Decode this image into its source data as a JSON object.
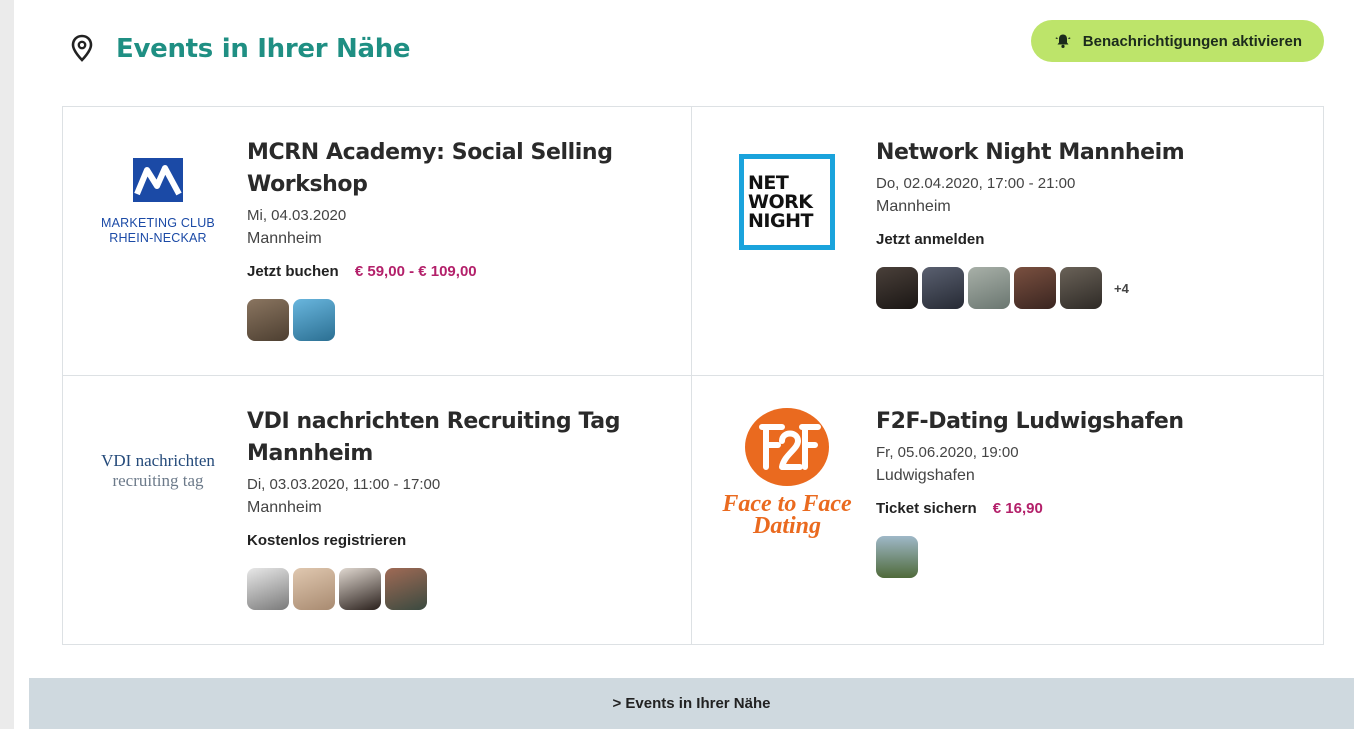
{
  "header": {
    "title": "Events in Ihrer Nähe",
    "notify_label": "Benachrichtigungen aktivieren"
  },
  "events": [
    {
      "title": "MCRN Academy: Social Selling Workshop",
      "date": "Mi, 04.03.2020",
      "location": "Mannheim",
      "cta": "Jetzt buchen",
      "price": "€ 59,00 - € 109,00",
      "logo": {
        "line1": "MARKETING CLUB",
        "line2": "RHEIN-NECKAR"
      },
      "attendee_colors": [
        "#6b5a45",
        "#3f8fb5"
      ]
    },
    {
      "title": "Network Night Mannheim",
      "date": "Do, 02.04.2020, 17:00 - 21:00",
      "location": "Mannheim",
      "cta": "Jetzt anmelden",
      "more_attendees": "+4",
      "logo": {
        "line1": "NET",
        "line2": "WORK",
        "line3": "NIGHT"
      },
      "attendee_colors": [
        "#2b2624",
        "#3c4150",
        "#8b9590",
        "#5a3b30",
        "#4a4540"
      ]
    },
    {
      "title": "VDI nachrichten Recruiting Tag Mannheim",
      "date": "Di, 03.03.2020, 11:00 - 17:00",
      "location": "Mannheim",
      "cta": "Kostenlos registrieren",
      "logo": {
        "line1": "VDI nachrichten",
        "line2": "recruiting tag"
      },
      "attendee_colors": [
        "#d8d8d8",
        "#c7a88f",
        "#3a2e2a",
        "#7a4b3c"
      ]
    },
    {
      "title": "F2F-Dating Ludwigshafen",
      "date": "Fr, 05.06.2020, 19:00",
      "location": "Ludwigshafen",
      "cta": "Ticket sichern",
      "price": "€ 16,90",
      "logo": {
        "line1": "Face to Face",
        "line2": "Dating"
      },
      "attendee_colors": [
        "#5b7a4a"
      ]
    }
  ],
  "footer": {
    "link": "> Events in Ihrer Nähe"
  },
  "colors": {
    "accent": "#1f8f83",
    "price": "#b3206a",
    "notify_bg": "#bde46a",
    "footer_bg": "#cfd9df"
  }
}
